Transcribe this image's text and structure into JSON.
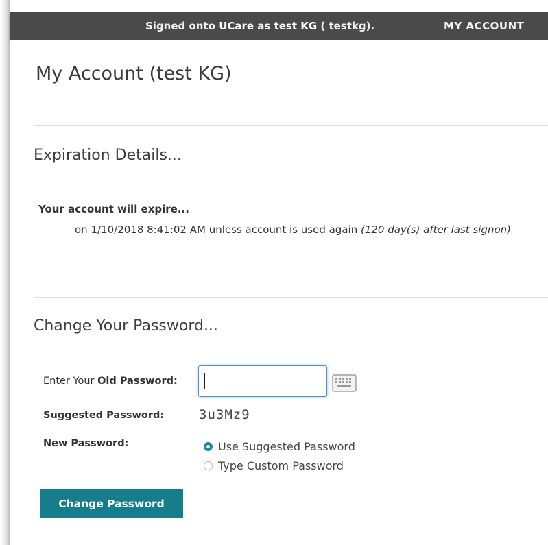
{
  "topbar": {
    "signed_prefix": "Signed onto ",
    "app_name": "UCare",
    "signed_mid": " as ",
    "user_display": "test KG",
    "signed_suffix": " ( testkg).",
    "my_account_label": "MY ACCOUNT"
  },
  "page": {
    "title": "My Account (test KG)"
  },
  "expiration": {
    "heading": "Expiration Details...",
    "label": "Your account will expire...",
    "detail_text": "on 1/10/2018 8:41:02 AM unless account is used again ",
    "detail_note": "(120 day(s) after last signon)"
  },
  "password": {
    "heading": "Change Your Password...",
    "old_label_prefix": "Enter Your ",
    "old_label_bold": "Old Password:",
    "old_value": "",
    "suggested_label": "Suggested Password:",
    "suggested_value": "3u3Mz9",
    "new_label": "New Password:",
    "options": [
      {
        "label": "Use Suggested Password",
        "selected": true
      },
      {
        "label": "Type Custom Password",
        "selected": false
      }
    ],
    "submit_label": "Change Password"
  },
  "colors": {
    "topbar": "#4a4a4a",
    "button": "#157d8b",
    "radio_selected": "#1a87a8",
    "annotation_arrow": "#c0161c"
  },
  "icons": [
    "keyboard-icon",
    "annotation-arrow-icon"
  ]
}
